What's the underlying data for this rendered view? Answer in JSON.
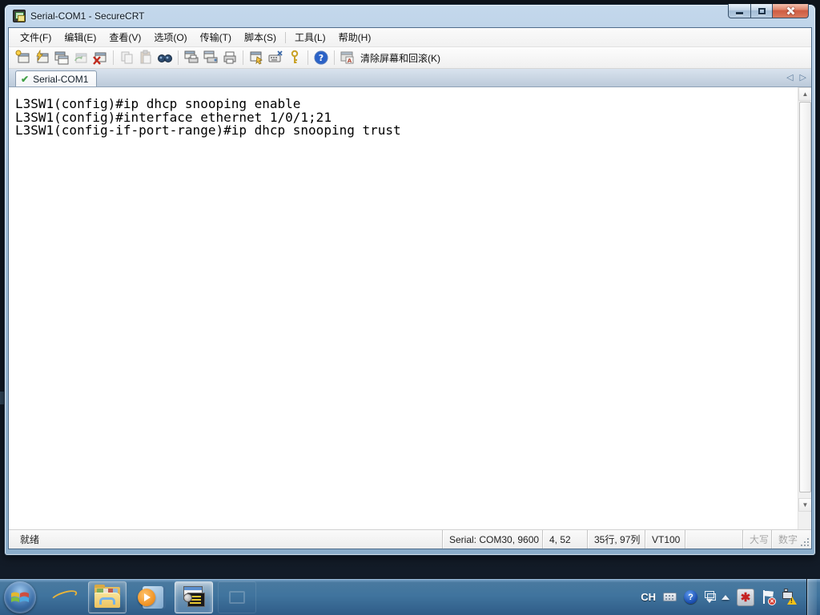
{
  "window": {
    "title": "Serial-COM1 - SecureCRT",
    "caption_buttons": [
      "minimize",
      "maximize",
      "close"
    ]
  },
  "menu": {
    "items": [
      "文件(F)",
      "编辑(E)",
      "查看(V)",
      "选项(O)",
      "传输(T)",
      "脚本(S)",
      "工具(L)",
      "帮助(H)"
    ]
  },
  "toolbar": {
    "icons": [
      "new-session",
      "quick-connect",
      "connect-in-tab",
      "reconnect",
      "disconnect",
      "copy",
      "paste",
      "find",
      "print-preview",
      "print-setup",
      "print",
      "session-options",
      "keymap-editor",
      "key",
      "help",
      "clear-screen"
    ],
    "clear_label": "清除屏幕和回滚(K)"
  },
  "tabs": {
    "active_label": "Serial-COM1"
  },
  "terminal": {
    "lines": [
      "L3SW1(config)#ip dhcp snooping enable",
      "L3SW1(config)#interface ethernet 1/0/1;21",
      "L3SW1(config-if-port-range)#ip dhcp snooping trust"
    ]
  },
  "statusbar": {
    "ready": "就绪",
    "serial": "Serial: COM30, 9600",
    "cursor_pos": "4,  52",
    "screen_size": "35行, 97列",
    "emulation": "VT100",
    "caps_lock": "大写",
    "num_lock": "数字"
  },
  "taskbar": {
    "buttons": [
      "start",
      "internet-explorer",
      "windows-explorer",
      "media-player",
      "securecrt",
      "ghost-app"
    ],
    "tray": {
      "ime_label": "CH",
      "icons": [
        "keyboard",
        "help",
        "ime-toolbar",
        "show-hidden",
        "security",
        "action-center-flag",
        "network-warning"
      ]
    }
  },
  "colors": {
    "titlebar": "#a3bfda",
    "close_button": "#cf5c42",
    "tab_check_green": "#43a047",
    "terminal_bg": "#ffffff",
    "terminal_text": "#000000",
    "taskbar_blue": "#40749e"
  }
}
